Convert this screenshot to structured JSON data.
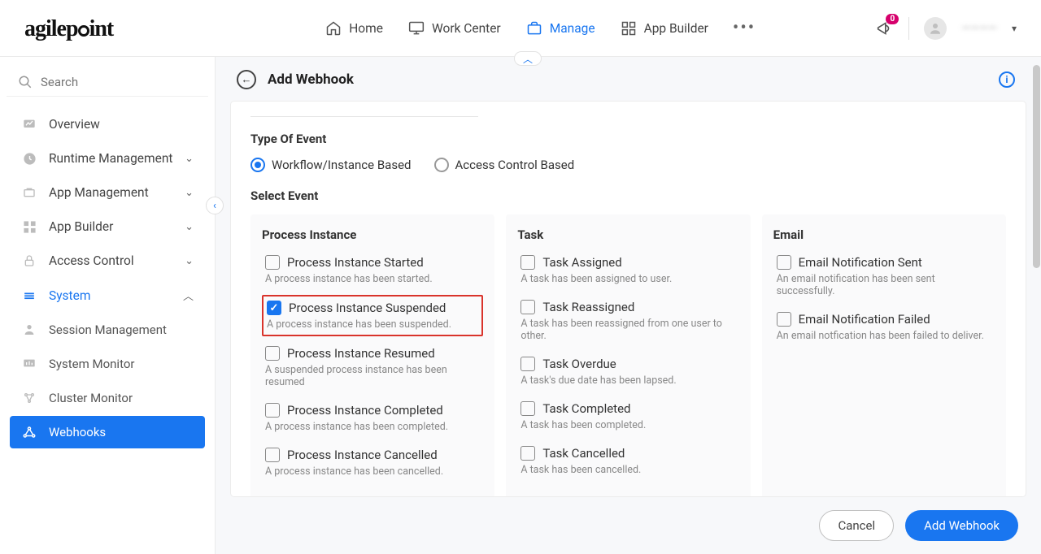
{
  "brand": "agilepoint",
  "topnav": {
    "home": "Home",
    "work_center": "Work Center",
    "manage": "Manage",
    "app_builder": "App Builder"
  },
  "notifications_count": "0",
  "user_name": "————",
  "search_placeholder": "Search",
  "sidebar": {
    "overview": "Overview",
    "runtime_mgmt": "Runtime Management",
    "app_mgmt": "App Management",
    "app_builder": "App Builder",
    "access_control": "Access Control",
    "system": "System",
    "session_mgmt": "Session Management",
    "system_monitor": "System Monitor",
    "cluster_monitor": "Cluster Monitor",
    "webhooks": "Webhooks"
  },
  "page": {
    "title": "Add Webhook",
    "type_of_event": "Type Of Event",
    "radio_workflow": "Workflow/Instance Based",
    "radio_access": "Access Control Based",
    "select_event": "Select Event"
  },
  "events": {
    "col1_title": "Process Instance",
    "col2_title": "Task",
    "col3_title": "Email",
    "pi_started": "Process Instance Started",
    "pi_started_d": "A process instance has been started.",
    "pi_suspended": "Process Instance Suspended",
    "pi_suspended_d": "A process instance has been suspended.",
    "pi_resumed": "Process Instance Resumed",
    "pi_resumed_d": "A suspended process instance has been resumed",
    "pi_completed": "Process Instance Completed",
    "pi_completed_d": "A process instance has been completed.",
    "pi_cancelled": "Process Instance Cancelled",
    "pi_cancelled_d": "A process instance has been cancelled.",
    "t_assigned": "Task Assigned",
    "t_assigned_d": "A task has been assigned to user.",
    "t_reassigned": "Task Reassigned",
    "t_reassigned_d": "A task has been reassigned from one user to other.",
    "t_overdue": "Task Overdue",
    "t_overdue_d": "A task's due date has been lapsed.",
    "t_completed": "Task Completed",
    "t_completed_d": "A task has been completed.",
    "t_cancelled": "Task Cancelled",
    "t_cancelled_d": "A task has been cancelled.",
    "e_sent": "Email Notification Sent",
    "e_sent_d": "An email notification has been sent successfully.",
    "e_failed": "Email Notification Failed",
    "e_failed_d": "An email notfication has been failed to deliver."
  },
  "footer": {
    "cancel": "Cancel",
    "add": "Add Webhook"
  },
  "colors": {
    "accent": "#1976f0",
    "danger": "#d9332b",
    "badge": "#d6006c"
  }
}
